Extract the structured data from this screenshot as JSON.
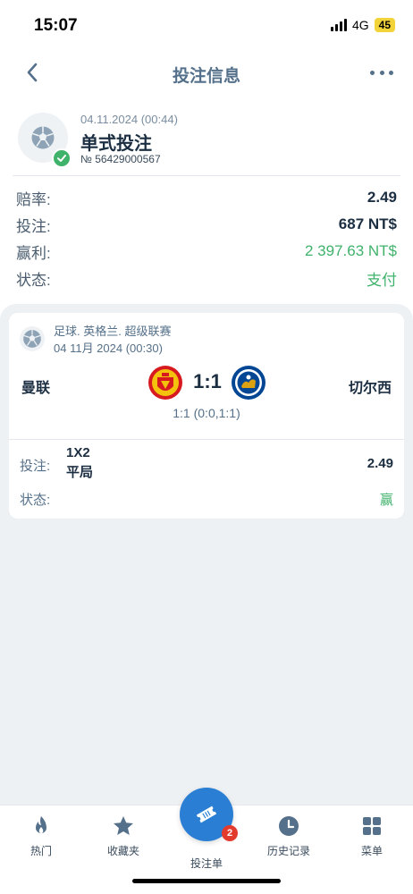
{
  "status_bar": {
    "time": "15:07",
    "network": "4G",
    "battery": "45"
  },
  "header": {
    "title": "投注信息",
    "back_icon": "chevron-left-icon",
    "more_icon": "more-dots-icon"
  },
  "bet": {
    "date": "04.11.2024 (00:44)",
    "type": "单式投注",
    "number": "№ 56429000567",
    "icon": "soccer-ball-icon",
    "status_icon": "check-icon"
  },
  "summary": {
    "odds_label": "赔率:",
    "odds_value": "2.49",
    "stake_label": "投注:",
    "stake_value": "687 NT$",
    "win_label": "赢利:",
    "win_value": "2 397.63 NT$",
    "status_label": "状态:",
    "status_value": "支付"
  },
  "match": {
    "league": "足球. 英格兰. 超级联赛",
    "date": "04 11月 2024 (00:30)",
    "home_team": "曼联",
    "away_team": "切尔西",
    "score": "1:1",
    "score_detail": "1:1 (0:0,1:1)",
    "pick_label": "投注:",
    "pick_market": "1X2",
    "pick_outcome": "平局",
    "pick_odds": "2.49",
    "result_label": "状态:",
    "result_value": "赢",
    "home_logo": "man-utd-crest-icon",
    "away_logo": "chelsea-crest-icon"
  },
  "tabs": [
    {
      "label": "热门",
      "icon": "flame-icon"
    },
    {
      "label": "收藏夹",
      "icon": "star-icon"
    },
    {
      "label": "投注单",
      "icon": "ticket-icon",
      "badge": "2"
    },
    {
      "label": "历史记录",
      "icon": "clock-icon"
    },
    {
      "label": "菜单",
      "icon": "grid-icon"
    }
  ],
  "colors": {
    "accent": "#2a7fd4",
    "success": "#3fb26b",
    "muted": "#55708a",
    "badge": "#e23b2e"
  }
}
